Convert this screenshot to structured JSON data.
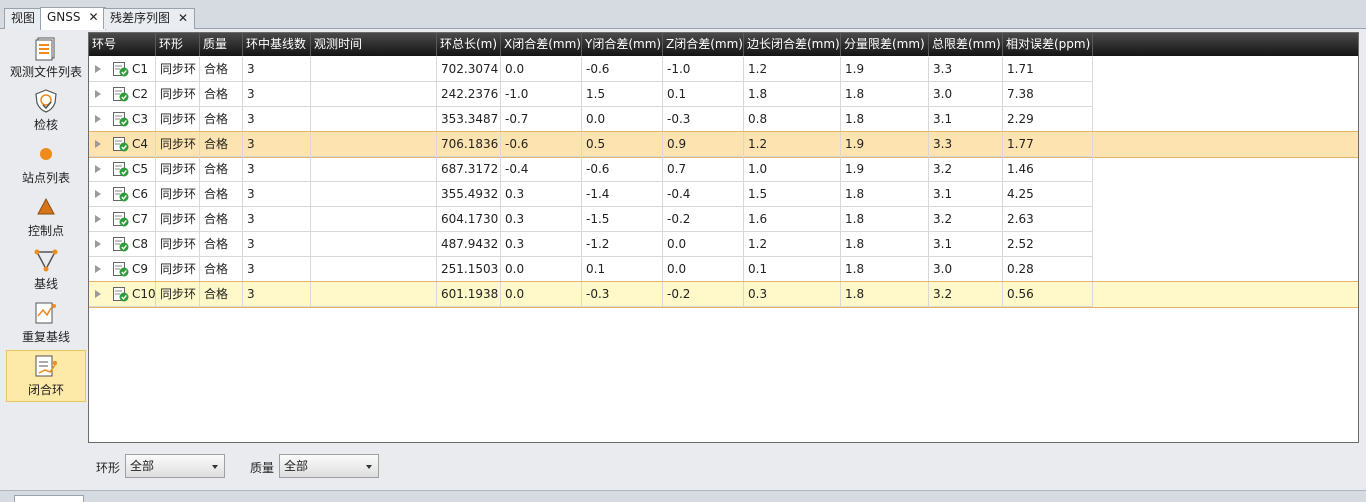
{
  "tabs": [
    {
      "label": "视图"
    },
    {
      "label": "GNSS"
    },
    {
      "label": "残差序列图"
    }
  ],
  "close_glyph": "✕",
  "sidebar": {
    "items": [
      {
        "label": "观测文件列表",
        "icon": "file-list-icon"
      },
      {
        "label": "检核",
        "icon": "qc-shield-icon"
      },
      {
        "label": "站点列表",
        "icon": "station-dot-icon"
      },
      {
        "label": "控制点",
        "icon": "control-triangle-icon"
      },
      {
        "label": "基线",
        "icon": "baseline-icon"
      },
      {
        "label": "重复基线",
        "icon": "repeat-baseline-icon"
      },
      {
        "label": "闭合环",
        "icon": "closed-loop-icon"
      }
    ]
  },
  "table": {
    "columns": [
      "环号",
      "环形",
      "质量",
      "环中基线数",
      "观测时间",
      "环总长(m)",
      "X闭合差(mm)",
      "Y闭合差(mm)",
      "Z闭合差(mm)",
      "边长闭合差(mm)",
      "分量限差(mm)",
      "总限差(mm)",
      "相对误差(ppm)"
    ],
    "rows": [
      [
        "C1",
        "同步环",
        "合格",
        "3",
        "",
        "702.3074",
        "0.0",
        "-0.6",
        "-1.0",
        "1.2",
        "1.9",
        "3.3",
        "1.71"
      ],
      [
        "C2",
        "同步环",
        "合格",
        "3",
        "",
        "242.2376",
        "-1.0",
        "1.5",
        "0.1",
        "1.8",
        "1.8",
        "3.0",
        "7.38"
      ],
      [
        "C3",
        "同步环",
        "合格",
        "3",
        "",
        "353.3487",
        "-0.7",
        "0.0",
        "-0.3",
        "0.8",
        "1.8",
        "3.1",
        "2.29"
      ],
      [
        "C4",
        "同步环",
        "合格",
        "3",
        "",
        "706.1836",
        "-0.6",
        "0.5",
        "0.9",
        "1.2",
        "1.9",
        "3.3",
        "1.77"
      ],
      [
        "C5",
        "同步环",
        "合格",
        "3",
        "",
        "687.3172",
        "-0.4",
        "-0.6",
        "0.7",
        "1.0",
        "1.9",
        "3.2",
        "1.46"
      ],
      [
        "C6",
        "同步环",
        "合格",
        "3",
        "",
        "355.4932",
        "0.3",
        "-1.4",
        "-0.4",
        "1.5",
        "1.8",
        "3.1",
        "4.25"
      ],
      [
        "C7",
        "同步环",
        "合格",
        "3",
        "",
        "604.1730",
        "0.3",
        "-1.5",
        "-0.2",
        "1.6",
        "1.8",
        "3.2",
        "2.63"
      ],
      [
        "C8",
        "同步环",
        "合格",
        "3",
        "",
        "487.9432",
        "0.3",
        "-1.2",
        "0.0",
        "1.2",
        "1.8",
        "3.1",
        "2.52"
      ],
      [
        "C9",
        "同步环",
        "合格",
        "3",
        "",
        "251.1503",
        "0.0",
        "0.1",
        "0.0",
        "0.1",
        "1.8",
        "3.0",
        "0.28"
      ],
      [
        "C10",
        "同步环",
        "合格",
        "3",
        "",
        "601.1938",
        "0.0",
        "-0.3",
        "-0.2",
        "0.3",
        "1.8",
        "3.2",
        "0.56"
      ]
    ]
  },
  "filters": {
    "ring_type_label": "环形",
    "ring_type_value": "全部",
    "quality_label": "质量",
    "quality_value": "全部"
  },
  "colors": {
    "selected_row": "#fde3b0",
    "current_row": "#fff8c8",
    "header_bg": "#1e1e1e",
    "accent_orange": "#f08a1c"
  }
}
